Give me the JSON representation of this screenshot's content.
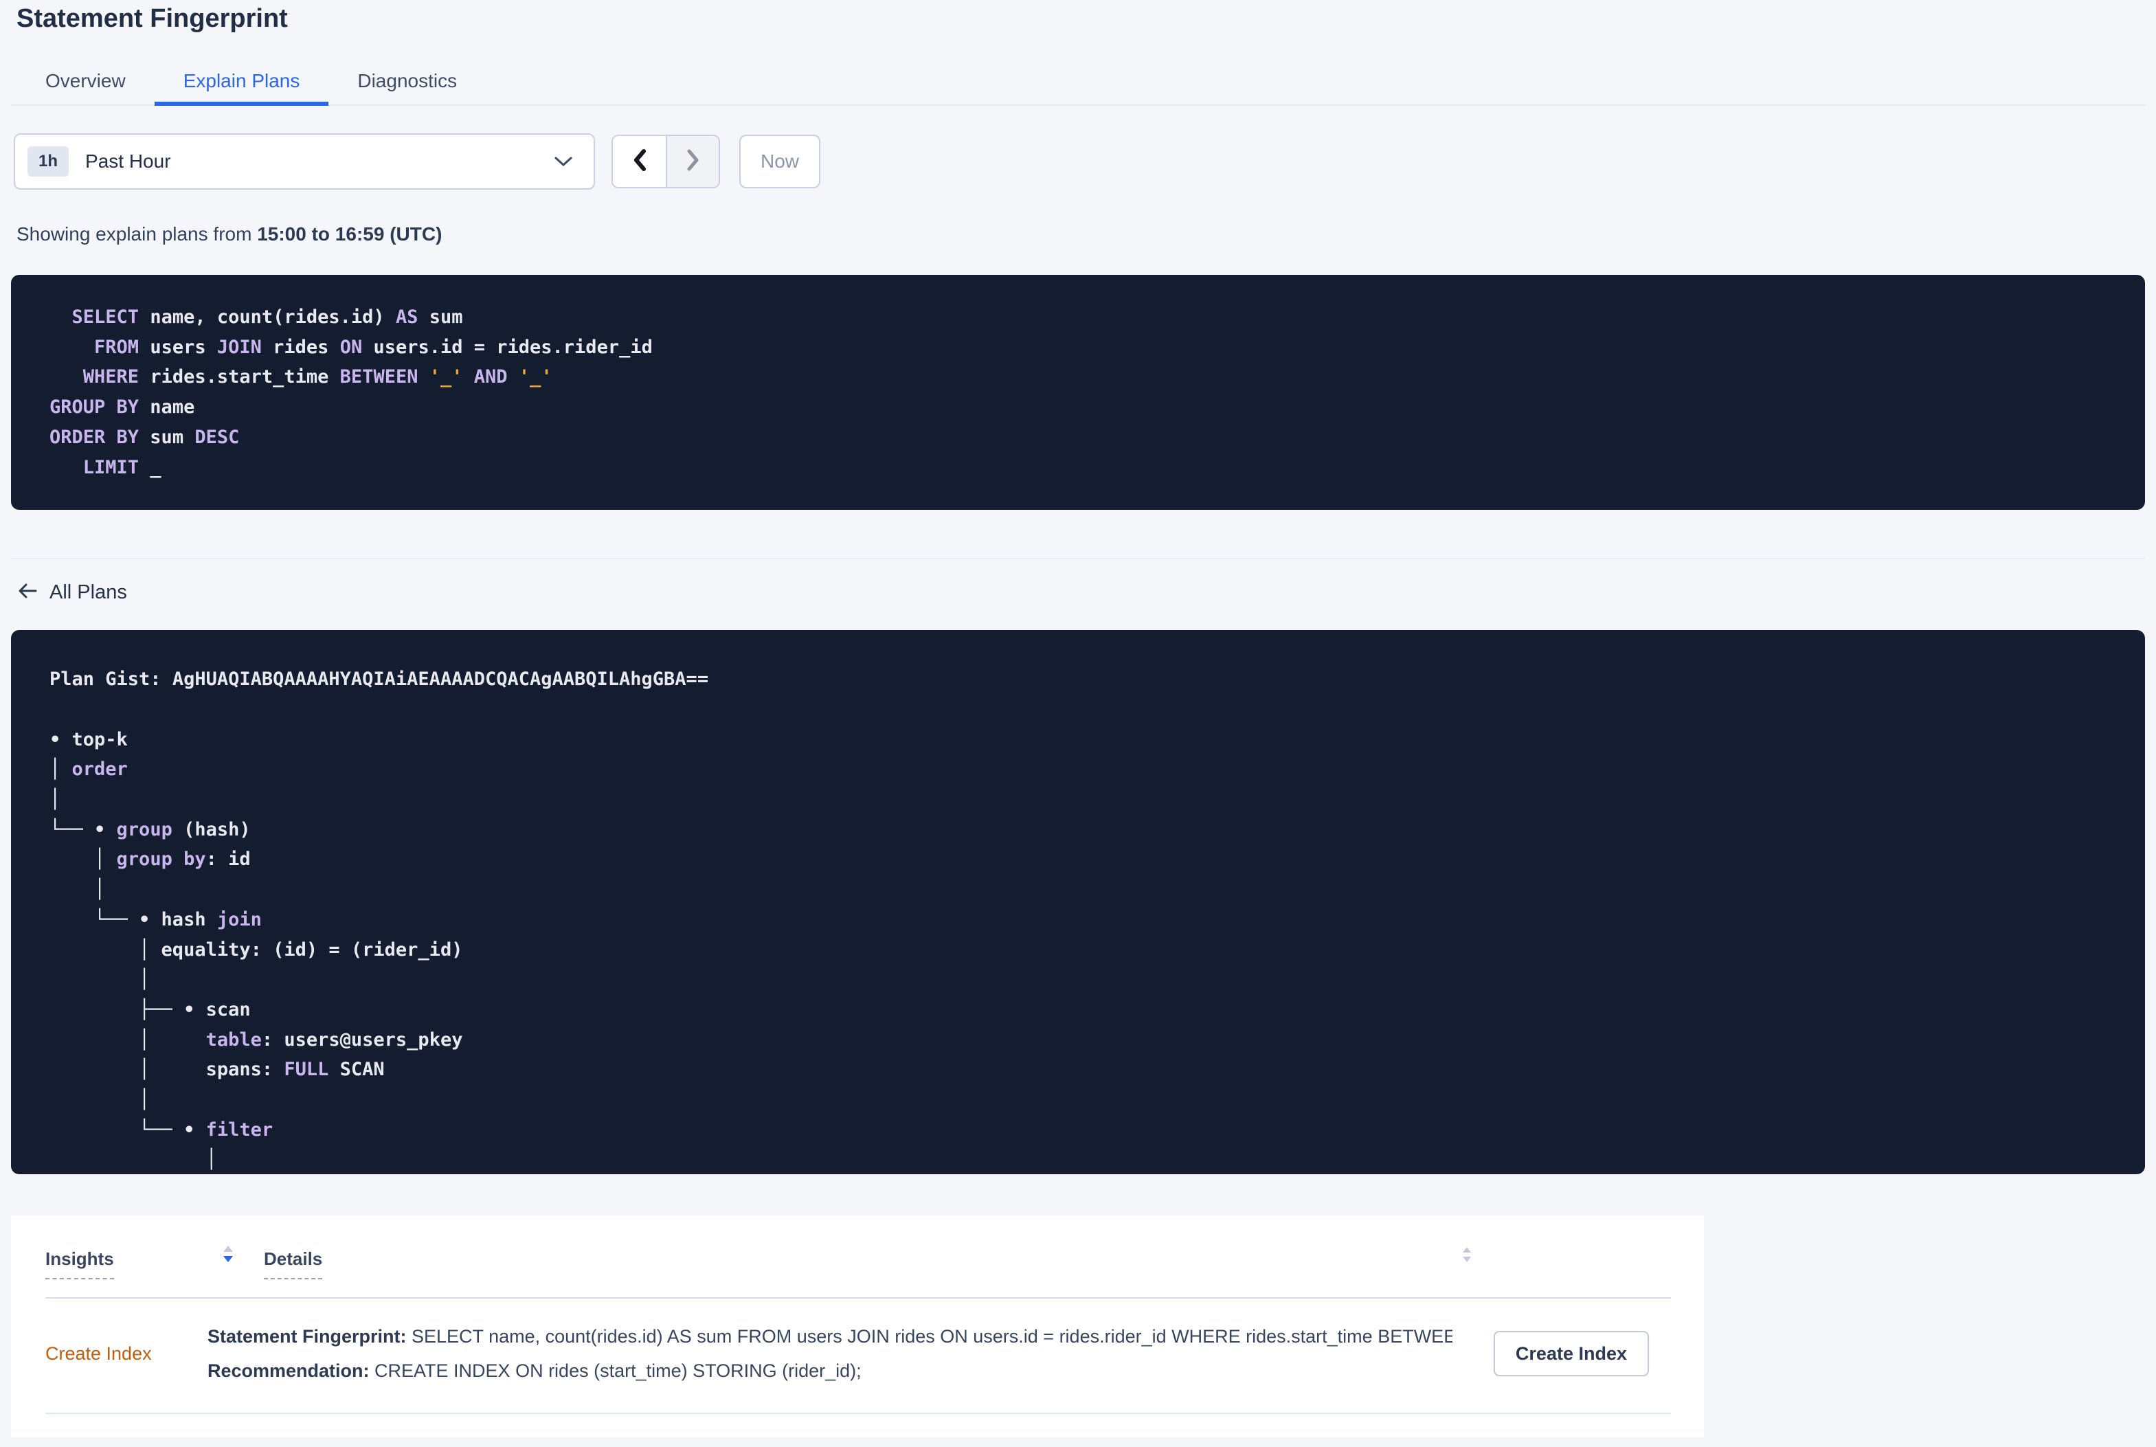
{
  "colors": {
    "accent-blue": "#2a66e8",
    "kw": "#c9b6ee",
    "lit": "#f0a43e",
    "code-bg": "#141c30",
    "code-fg": "#e8eaf0",
    "insight-orange": "#bf5e0e"
  },
  "page": {
    "title": "Statement Fingerprint",
    "tabs": [
      {
        "label": "Overview"
      },
      {
        "label": "Explain Plans"
      },
      {
        "label": "Diagnostics"
      }
    ],
    "time_picker": {
      "badge": "1h",
      "label": "Past Hour"
    },
    "now_button_label": "Now",
    "showing_prefix": "Showing explain plans from ",
    "showing_range": "15:00 to 16:59 (UTC)",
    "all_plans_label": "All Plans"
  },
  "sql_statement": {
    "lines": [
      [
        {
          "c": "pl",
          "t": "  "
        },
        {
          "c": "kw",
          "t": "SELECT"
        },
        {
          "c": "pl",
          "t": " name, count(rides.id) "
        },
        {
          "c": "kw",
          "t": "AS"
        },
        {
          "c": "pl",
          "t": " sum"
        }
      ],
      [
        {
          "c": "pl",
          "t": "    "
        },
        {
          "c": "kw",
          "t": "FROM"
        },
        {
          "c": "pl",
          "t": " users "
        },
        {
          "c": "kw",
          "t": "JOIN"
        },
        {
          "c": "pl",
          "t": " rides "
        },
        {
          "c": "kw",
          "t": "ON"
        },
        {
          "c": "pl",
          "t": " users.id = rides.rider_id"
        }
      ],
      [
        {
          "c": "pl",
          "t": "   "
        },
        {
          "c": "kw",
          "t": "WHERE"
        },
        {
          "c": "pl",
          "t": " rides.start_time "
        },
        {
          "c": "kw",
          "t": "BETWEEN"
        },
        {
          "c": "pl",
          "t": " "
        },
        {
          "c": "lit",
          "t": "'_'"
        },
        {
          "c": "pl",
          "t": " "
        },
        {
          "c": "kw",
          "t": "AND"
        },
        {
          "c": "pl",
          "t": " "
        },
        {
          "c": "lit",
          "t": "'_'"
        }
      ],
      [
        {
          "c": "kw",
          "t": "GROUP BY"
        },
        {
          "c": "pl",
          "t": " name"
        }
      ],
      [
        {
          "c": "kw",
          "t": "ORDER BY"
        },
        {
          "c": "pl",
          "t": " sum "
        },
        {
          "c": "kw",
          "t": "DESC"
        }
      ],
      [
        {
          "c": "pl",
          "t": "   "
        },
        {
          "c": "kw",
          "t": "LIMIT"
        },
        {
          "c": "pl",
          "t": " _"
        }
      ]
    ]
  },
  "plan": {
    "gist_label": "Plan Gist: ",
    "gist": "AgHUAQIABQAAAAHYAQIAiAEAAAADCQACAgAABQILAhgGBA==",
    "tree": [
      [
        {
          "c": "pl",
          "t": "• top-k"
        }
      ],
      [
        {
          "c": "pl",
          "t": "│ "
        },
        {
          "c": "kw",
          "t": "order"
        }
      ],
      [
        {
          "c": "pl",
          "t": "│"
        }
      ],
      [
        {
          "c": "pl",
          "t": "└── • "
        },
        {
          "c": "kw",
          "t": "group"
        },
        {
          "c": "pl",
          "t": " (hash)"
        }
      ],
      [
        {
          "c": "pl",
          "t": "    │ "
        },
        {
          "c": "kw",
          "t": "group by"
        },
        {
          "c": "pl",
          "t": ": id"
        }
      ],
      [
        {
          "c": "pl",
          "t": "    │"
        }
      ],
      [
        {
          "c": "pl",
          "t": "    └── • hash "
        },
        {
          "c": "kw",
          "t": "join"
        }
      ],
      [
        {
          "c": "pl",
          "t": "        │ equality: (id) = (rider_id)"
        }
      ],
      [
        {
          "c": "pl",
          "t": "        │"
        }
      ],
      [
        {
          "c": "pl",
          "t": "        ├── • scan"
        }
      ],
      [
        {
          "c": "pl",
          "t": "        │     "
        },
        {
          "c": "kw",
          "t": "table"
        },
        {
          "c": "pl",
          "t": ": users@users_pkey"
        }
      ],
      [
        {
          "c": "pl",
          "t": "        │     spans: "
        },
        {
          "c": "kw",
          "t": "FULL"
        },
        {
          "c": "pl",
          "t": " SCAN"
        }
      ],
      [
        {
          "c": "pl",
          "t": "        │"
        }
      ],
      [
        {
          "c": "pl",
          "t": "        └── • "
        },
        {
          "c": "kw",
          "t": "filter"
        }
      ],
      [
        {
          "c": "pl",
          "t": "              │"
        }
      ]
    ]
  },
  "insights_table": {
    "columns": {
      "insights": "Insights",
      "details": "Details"
    },
    "rows": [
      {
        "insight": "Create Index",
        "details": [
          {
            "label": "Statement Fingerprint:",
            "text": " SELECT name, count(rides.id) AS sum FROM users JOIN rides ON users.id = rides.rider_id WHERE rides.start_time BETWEEN '_…"
          },
          {
            "label": "Recommendation:",
            "text": " CREATE INDEX ON rides (start_time) STORING (rider_id);"
          }
        ],
        "action_label": "Create Index"
      }
    ]
  }
}
